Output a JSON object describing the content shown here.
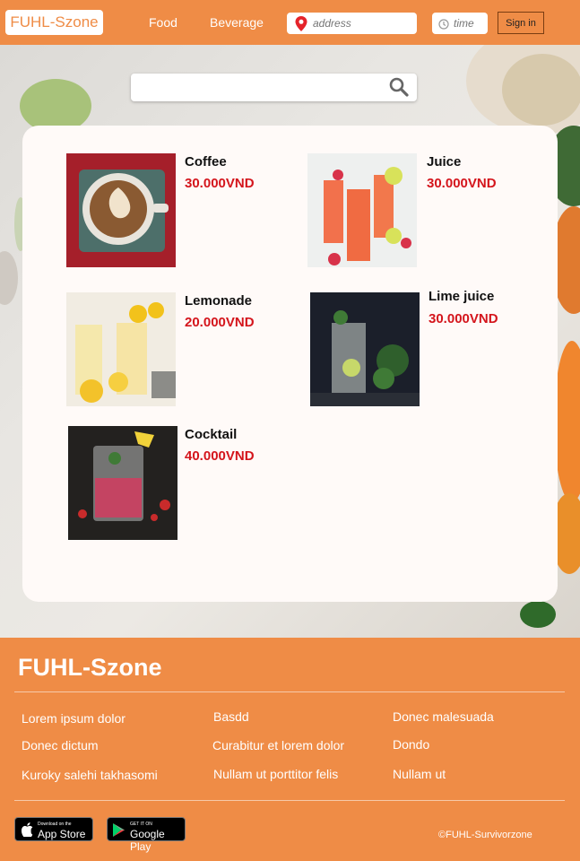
{
  "header": {
    "logo": "FUHL-Szone",
    "nav": [
      "Food",
      "Beverage"
    ],
    "address_placeholder": "address",
    "time_placeholder": "time",
    "signin": "Sign in"
  },
  "search": {
    "placeholder": ""
  },
  "products": [
    {
      "name": "Coffee",
      "price": "30.000VND"
    },
    {
      "name": "Juice",
      "price": "30.000VND"
    },
    {
      "name": "Lemonade",
      "price": "20.000VND"
    },
    {
      "name": "Lime juice",
      "price": "30.000VND"
    },
    {
      "name": "Cocktail",
      "price": "40.000VND"
    }
  ],
  "footer": {
    "brand": "FUHL-Szone",
    "col1": [
      "Lorem ipsum dolor",
      "Donec dictum",
      "Kuroky salehi takhasomi"
    ],
    "col2": [
      "Basdd",
      "Curabitur et lorem dolor",
      "Nullam ut porttitor felis"
    ],
    "col3": [
      "Donec malesuada",
      "Dondo",
      "Nullam ut"
    ],
    "appstore_small": "Download on the",
    "appstore_big": "App Store",
    "googleplay_small": "GET IT ON",
    "googleplay_big": "Google Play",
    "copyright": "©FUHL-Survivorzone"
  },
  "colors": {
    "accent": "#ef8c46",
    "price": "#d4151c",
    "panel": "#fffaf8"
  }
}
